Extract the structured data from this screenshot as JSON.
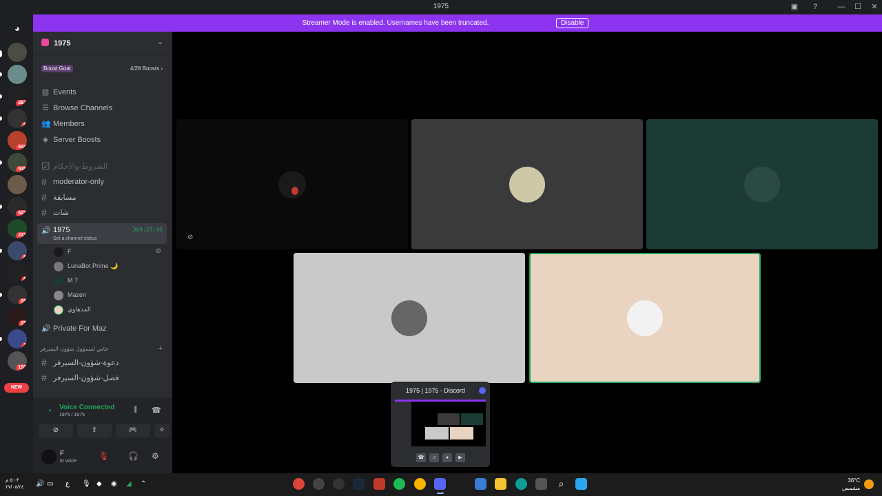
{
  "window": {
    "title": "1975",
    "controls": {
      "minimize": "—",
      "maximize": "☐",
      "close": "✕"
    }
  },
  "banner": {
    "text": "Streamer Mode is enabled. Usernames have been truncated.",
    "button": "Disable"
  },
  "guilds": {
    "badges": [
      "262",
      "6",
      "644",
      "535",
      "627",
      "223",
      "6",
      "6",
      "26",
      "25",
      "1",
      "193"
    ],
    "new_label": "NEW"
  },
  "server": {
    "name": "1975",
    "boost_goal": "Boost Goal",
    "boost_count": "4/28 Boosts ›",
    "nav": [
      "Events",
      "Browse Channels",
      "Members",
      "Server Boosts"
    ],
    "channels": [
      "الشروط-والأحكام",
      "moderator-only",
      "مسابقة",
      "شات"
    ],
    "voice_channel": {
      "name": "1975",
      "timer": "309:27:45",
      "status": "Set a channel status"
    },
    "voice_users": [
      "F",
      "LunaBot Prime 🌙",
      "M 7",
      "Mazen",
      "المدهاوي"
    ],
    "private_channel": "Private For Maz",
    "category": "خاص لمسؤول شؤون السيرفر",
    "category_channels": [
      "دعوة-شؤون-السيرفر",
      "فصل-شؤون-السيرفر"
    ]
  },
  "voice_panel": {
    "status": "Voice Connected",
    "sub": "1975 / 1975"
  },
  "user": {
    "name": "F",
    "status": "In voice"
  },
  "preview": {
    "title": "1975 | 1975 - Discord"
  },
  "taskbar": {
    "time": "٥:٠٣ م",
    "date": "٢٧/٠٨/٢٤",
    "lang": "ع",
    "weather_temp": "36°C",
    "weather_desc": "مشمس"
  },
  "colors": {
    "brand_purple": "#8c34f0",
    "voice_green": "#23a55a",
    "notif_red": "#f23f43"
  }
}
